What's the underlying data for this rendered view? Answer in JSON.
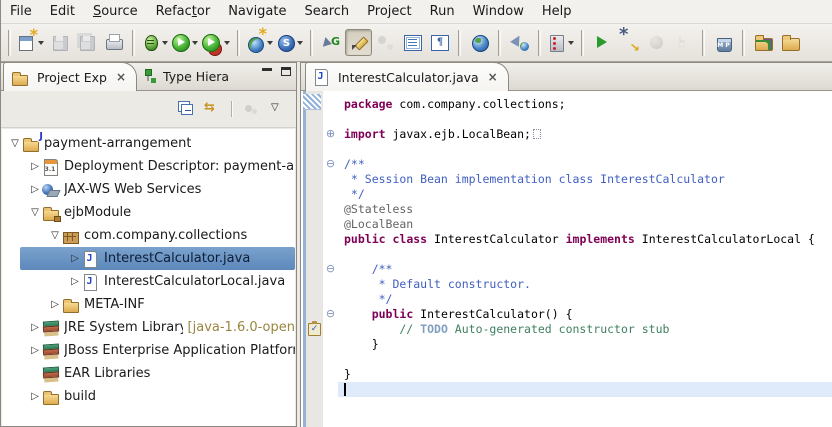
{
  "colors": {
    "selection": "#6b94c4",
    "keyword": "#7f0055",
    "javadoc": "#3f5fbf",
    "comment": "#3f7f5f",
    "task_tag": "#7f9fbf",
    "annotation": "#646464",
    "library_detail": "#998540",
    "current_line": "#dfeafa"
  },
  "menubar": {
    "items": [
      {
        "label": "File"
      },
      {
        "label": "Edit"
      },
      {
        "label": "Source",
        "underline": 0
      },
      {
        "label": "Refactor",
        "underline": 5
      },
      {
        "label": "Navigate"
      },
      {
        "label": "Search"
      },
      {
        "label": "Project"
      },
      {
        "label": "Run"
      },
      {
        "label": "Window"
      },
      {
        "label": "Help"
      }
    ]
  },
  "toolbar": {
    "groups": [
      {
        "buttons": [
          {
            "name": "new-wizard",
            "dropdown": true
          },
          {
            "name": "save",
            "disabled": true
          },
          {
            "name": "save-all",
            "disabled": true
          },
          {
            "name": "print"
          }
        ]
      },
      {
        "buttons": [
          {
            "name": "debug",
            "dropdown": true
          },
          {
            "name": "run",
            "dropdown": true
          },
          {
            "name": "run-external",
            "dropdown": true
          }
        ]
      },
      {
        "buttons": [
          {
            "name": "new-web-service",
            "dropdown": true
          },
          {
            "name": "soap-service",
            "dropdown": true
          }
        ]
      },
      {
        "buttons": [
          {
            "name": "generate-web-service"
          },
          {
            "name": "highlight-marker",
            "pressed": true
          },
          {
            "name": "mark-occurrences",
            "disabled": true
          },
          {
            "name": "show-list-view"
          },
          {
            "name": "show-whitespace"
          }
        ]
      },
      {
        "buttons": [
          {
            "name": "web-browser"
          }
        ]
      },
      {
        "buttons": [
          {
            "name": "launch-web-app"
          }
        ]
      },
      {
        "buttons": [
          {
            "name": "server-palette",
            "dropdown": true
          }
        ]
      },
      {
        "buttons": [
          {
            "name": "resume"
          },
          {
            "name": "step-wizard"
          },
          {
            "name": "stop",
            "disabled": true
          },
          {
            "name": "suspend",
            "disabled": true
          }
        ]
      },
      {
        "buttons": [
          {
            "name": "clean-publish"
          }
        ]
      },
      {
        "buttons": [
          {
            "name": "import-folder"
          },
          {
            "name": "open-folder"
          }
        ]
      }
    ]
  },
  "explorer": {
    "tabs": [
      {
        "label": "Project Exp",
        "active": true,
        "closable": true
      },
      {
        "label": "Type Hiera"
      }
    ],
    "toolbar": {
      "items": [
        {
          "name": "collapse-all"
        },
        {
          "name": "link-with-editor"
        },
        {
          "sep": true
        },
        {
          "name": "menu-extras",
          "disabled": true
        },
        {
          "name": "view-menu"
        }
      ]
    },
    "tree": [
      {
        "level": 0,
        "expander": "open",
        "icon": "folder",
        "badge": "java",
        "label": "payment-arrangement"
      },
      {
        "level": 1,
        "expander": "closed",
        "icon": "deployment-descriptor",
        "label": "Deployment Descriptor: payment-arrangement"
      },
      {
        "level": 1,
        "expander": "closed",
        "icon": "jaxws-services",
        "label": "JAX-WS Web Services"
      },
      {
        "level": 1,
        "expander": "open",
        "icon": "folder",
        "badge": "box",
        "label": "ejbModule"
      },
      {
        "level": 2,
        "expander": "open",
        "icon": "package",
        "label": "com.company.collections"
      },
      {
        "level": 3,
        "expander": "closed",
        "icon": "java-file",
        "label": "InterestCalculator.java",
        "selected": true
      },
      {
        "level": 3,
        "expander": "closed",
        "icon": "java-file",
        "label": "InterestCalculatorLocal.java"
      },
      {
        "level": 2,
        "expander": "closed",
        "icon": "folder",
        "label": "META-INF"
      },
      {
        "level": 1,
        "expander": "closed",
        "icon": "library",
        "label": "JRE System Library",
        "detail": "[java-1.6.0-open"
      },
      {
        "level": 1,
        "expander": "closed",
        "icon": "library",
        "label": "JBoss Enterprise Application Platform"
      },
      {
        "level": 1,
        "expander": "none",
        "icon": "library",
        "label": "EAR Libraries"
      },
      {
        "level": 1,
        "expander": "closed",
        "icon": "folder",
        "label": "build"
      }
    ]
  },
  "editor": {
    "tab": {
      "label": "InterestCalculator.java",
      "closable": true
    },
    "lines": [
      {
        "segs": [
          {
            "t": "package",
            "c": "kw"
          },
          {
            "t": " com.company.collections;",
            "c": "pl"
          }
        ]
      },
      {
        "segs": []
      },
      {
        "fold": "plus",
        "foldbox": true,
        "segs": [
          {
            "t": "import",
            "c": "kw"
          },
          {
            "t": " javax.ejb.LocalBean;",
            "c": "pl"
          }
        ]
      },
      {
        "segs": []
      },
      {
        "fold": "minus",
        "segs": [
          {
            "t": "/**",
            "c": "doc"
          }
        ]
      },
      {
        "segs": [
          {
            "t": " * Session Bean implementation class InterestCalculator",
            "c": "doc"
          }
        ]
      },
      {
        "segs": [
          {
            "t": " */",
            "c": "doc"
          }
        ]
      },
      {
        "segs": [
          {
            "t": "@Stateless",
            "c": "ann"
          }
        ]
      },
      {
        "segs": [
          {
            "t": "@LocalBean",
            "c": "ann"
          }
        ]
      },
      {
        "segs": [
          {
            "t": "public",
            "c": "kw"
          },
          {
            "t": " ",
            "c": "pl"
          },
          {
            "t": "class",
            "c": "kw"
          },
          {
            "t": " InterestCalculator ",
            "c": "pl"
          },
          {
            "t": "implements",
            "c": "kw"
          },
          {
            "t": " InterestCalculatorLocal {",
            "c": "pl"
          }
        ]
      },
      {
        "segs": []
      },
      {
        "fold": "minus",
        "segs": [
          {
            "t": "    /**",
            "c": "doc"
          }
        ]
      },
      {
        "segs": [
          {
            "t": "     * Default constructor.",
            "c": "doc"
          }
        ]
      },
      {
        "segs": [
          {
            "t": "     */",
            "c": "doc"
          }
        ]
      },
      {
        "fold": "minus",
        "segs": [
          {
            "t": "    ",
            "c": "pl"
          },
          {
            "t": "public",
            "c": "kw"
          },
          {
            "t": " InterestCalculator() {",
            "c": "pl"
          }
        ]
      },
      {
        "task": true,
        "segs": [
          {
            "t": "        // ",
            "c": "cm"
          },
          {
            "t": "TODO",
            "c": "todo"
          },
          {
            "t": " Auto-generated constructor stub",
            "c": "cm"
          }
        ]
      },
      {
        "segs": [
          {
            "t": "    }",
            "c": "pl"
          }
        ]
      },
      {
        "segs": []
      },
      {
        "segs": [
          {
            "t": "}",
            "c": "pl"
          }
        ]
      },
      {
        "current": true,
        "cursor": true,
        "segs": []
      }
    ]
  }
}
